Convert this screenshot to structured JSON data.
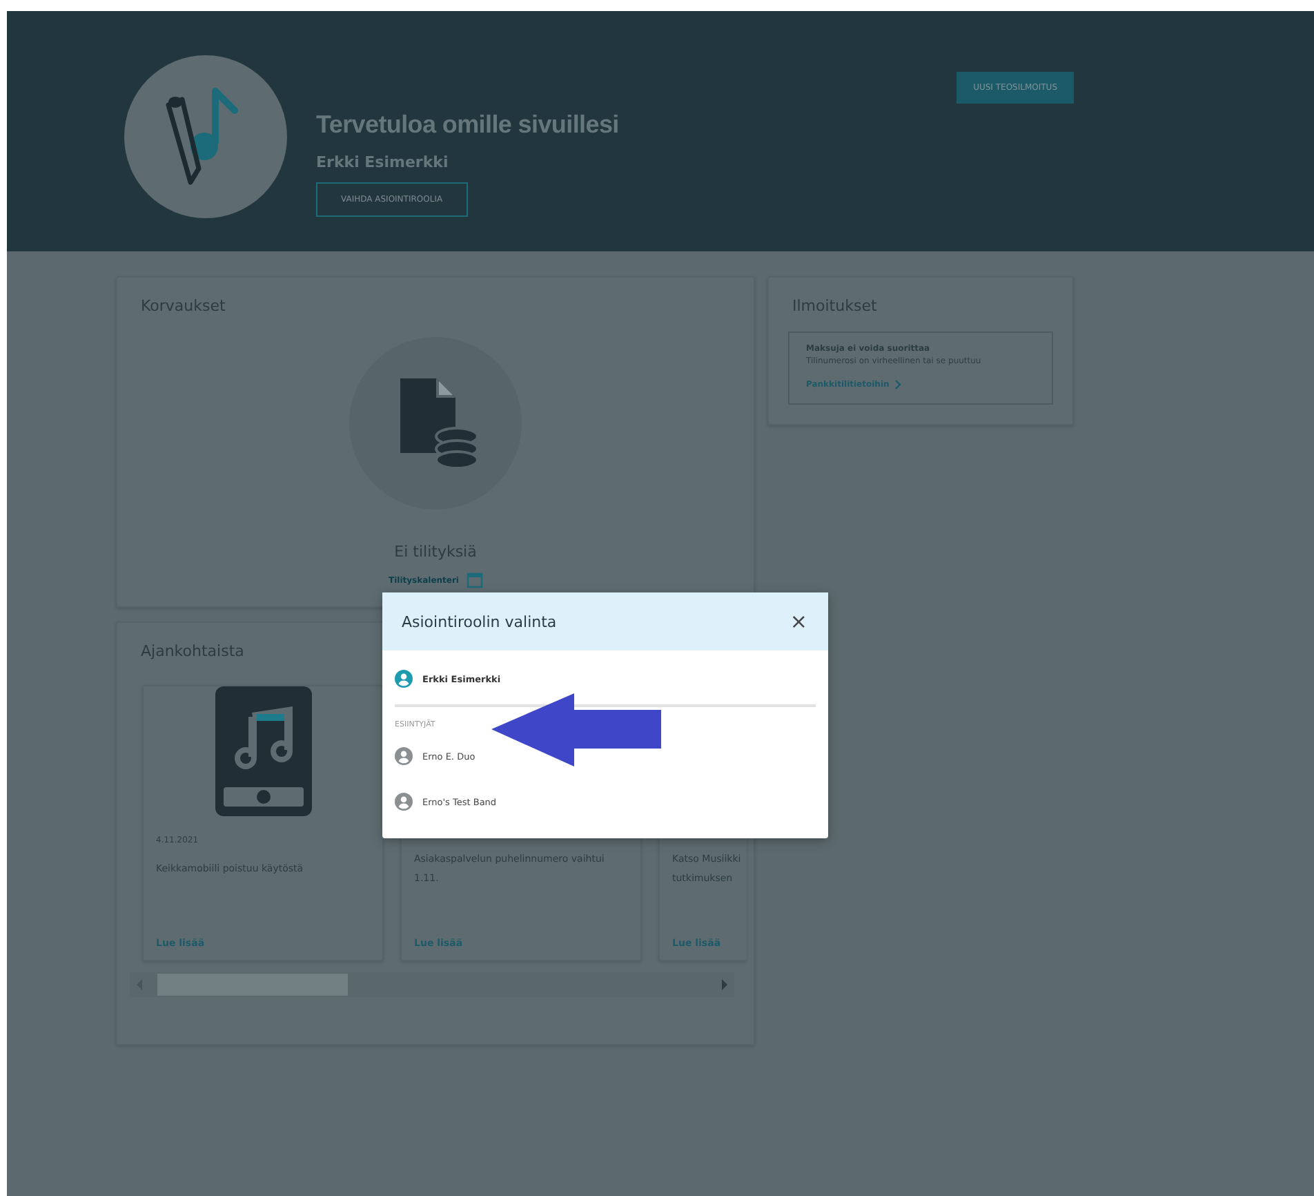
{
  "header": {
    "title": "Tervetuloa omille sivuillesi",
    "user_name": "Erkki Esimerkki",
    "switch_role_button": "VAIHDA ASIOINTIROOLIA",
    "new_work_button": "UUSI TEOSILMOITUS"
  },
  "compensations": {
    "title": "Korvaukset",
    "empty_text": "Ei tilityksiä",
    "calendar_link": "Tilityskalenteri"
  },
  "notifications": {
    "title": "Ilmoitukset",
    "items": [
      {
        "title": "Maksuja ei voida suorittaa",
        "text": "Tilinumerosi on virheellinen tai se puuttuu",
        "link": "Pankkitilitietoihin"
      }
    ]
  },
  "news": {
    "title": "Ajankohtaista",
    "items": [
      {
        "date": "4.11.2021",
        "title": "Keikkamobiili poistuu käytöstä",
        "link": "Lue lisää"
      },
      {
        "title": "Asiakaspalvelun puhelinnumero vaihtui 1.11.",
        "link": "Lue lisää"
      },
      {
        "title": "Katso Musiikki tutkimuksen",
        "link": "Lue lisää"
      }
    ]
  },
  "dialog": {
    "title": "Asiointiroolin valinta",
    "close": "×",
    "primary": {
      "name": "Erkki Esimerkki",
      "selected": true
    },
    "section_label": "ESIINTYJÄT",
    "roles": [
      {
        "name": "Erno E. Duo",
        "selected": false
      },
      {
        "name": "Erno's Test Band",
        "selected": false
      }
    ]
  }
}
